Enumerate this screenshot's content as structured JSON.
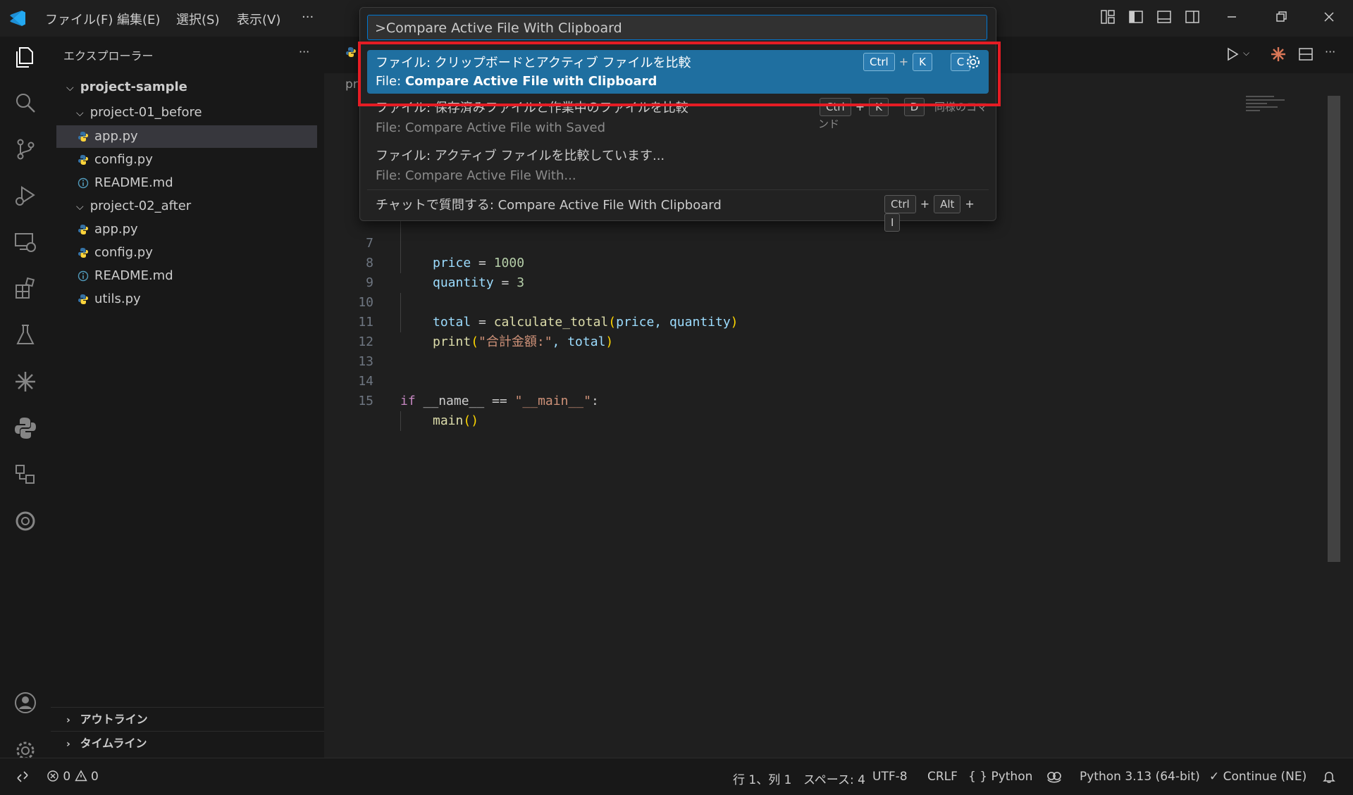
{
  "menu": [
    "ファイル(F)",
    "編集(E)",
    "選択(S)",
    "表示(V)",
    "···"
  ],
  "explorer": {
    "title": "エクスプローラー",
    "more": "···",
    "root": "project-sample",
    "folder1": "project-01_before",
    "folder1_files": [
      "app.py",
      "config.py",
      "README.md"
    ],
    "folder2": "project-02_after",
    "folder2_files": [
      "app.py",
      "config.py",
      "README.md",
      "utils.py"
    ],
    "outline": "アウトライン",
    "timeline": "タイムライン"
  },
  "editor": {
    "tab_partial": "pr",
    "lines": [
      {
        "n": "7"
      },
      {
        "n": "8"
      },
      {
        "n": "9"
      },
      {
        "n": "10"
      },
      {
        "n": "11"
      },
      {
        "n": "12"
      },
      {
        "n": "13"
      },
      {
        "n": "14"
      },
      {
        "n": "15"
      }
    ],
    "code": {
      "l7_var": "price",
      "l7_eq": " = ",
      "l7_num": "1000",
      "l8_var": "quantity",
      "l8_eq": " = ",
      "l8_num": "3",
      "l10_var": "total",
      "l10_eq": " = ",
      "l10_fn": "calculate_total",
      "l10_open": "(",
      "l10_args": "price, quantity",
      "l10_close": ")",
      "l11_fn": "print",
      "l11_open": "(",
      "l11_str": "\"合計金額:\"",
      "l11_rest": ", total",
      "l11_close": ")",
      "l14_kw": "if",
      "l14_rest": " __name__ == ",
      "l14_str": "\"__main__\"",
      "l14_colon": ":",
      "l15_fn": "main",
      "l15_paren": "()"
    }
  },
  "palette": {
    "input": ">Compare Active File With Clipboard",
    "items": [
      {
        "line1": "ファイル: クリップボードとアクティブ ファイルを比較",
        "line2_prefix": "File: ",
        "line2_bold": "Compare Active File with Clipboard",
        "keys": [
          "Ctrl",
          "+",
          "K",
          "C"
        ]
      },
      {
        "line1": "ファイル: 保存済みファイルと作業中のファイルを比較",
        "line2": "File: Compare Active File with Saved",
        "keys": [
          "Ctrl",
          "+",
          "K",
          "D"
        ],
        "extra": "同様のコマンド"
      },
      {
        "line1": "ファイル: アクティブ ファイルを比較しています...",
        "line2": "File: Compare Active File With..."
      },
      {
        "line1": "チャットで質問する: Compare Active File With Clipboard",
        "keys": [
          "Ctrl",
          "+",
          "Alt",
          "+",
          "I"
        ]
      }
    ]
  },
  "status": {
    "errors": "0",
    "warnings": "0",
    "position": "行 1、列 1",
    "spaces": "スペース: 4",
    "encoding": "UTF-8",
    "eol": "CRLF",
    "lang_braces": "{ }",
    "language": "Python",
    "interpreter": "Python 3.13 (64-bit)",
    "continue": "Continue (NE)"
  },
  "colors": {
    "accent": "#0078d4",
    "selected_item": "#1f6fa0",
    "highlight_box": "#e51c24"
  }
}
